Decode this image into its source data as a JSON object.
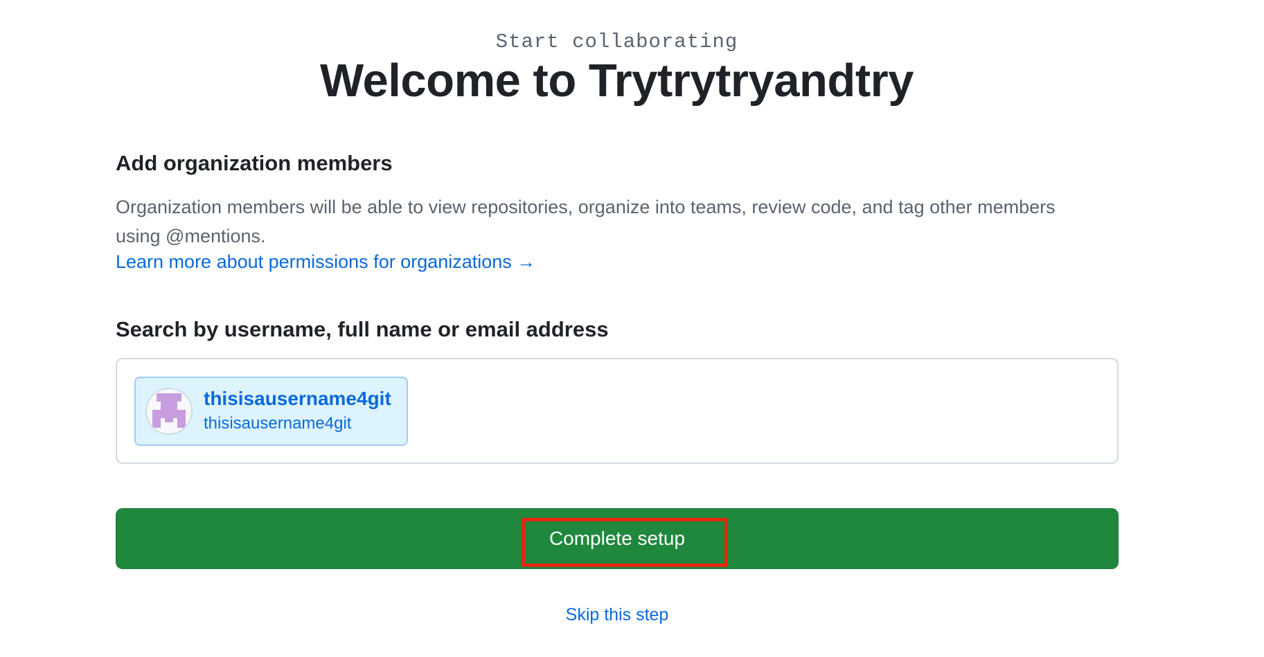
{
  "header": {
    "eyebrow": "Start collaborating",
    "title": "Welcome to Trytrytryandtry"
  },
  "members_section": {
    "heading": "Add organization members",
    "description": "Organization members will be able to view repositories, organize into teams, review code, and tag other members using @mentions.",
    "learn_more_link": "Learn more about permissions for organizations →"
  },
  "search": {
    "label": "Search by username, full name or email address",
    "placeholder": "",
    "selected_users": [
      {
        "name": "thisisausername4git",
        "login": "thisisausername4git",
        "avatar_icon": "identicon-avatar",
        "avatar_color": "#c79de0"
      }
    ]
  },
  "actions": {
    "complete_button": "Complete setup",
    "skip_link": "Skip this step"
  },
  "colors": {
    "primary_button": "#1f883d",
    "link": "#0969da",
    "chip_background": "#ddf4ff",
    "highlight": "#e8260f"
  }
}
